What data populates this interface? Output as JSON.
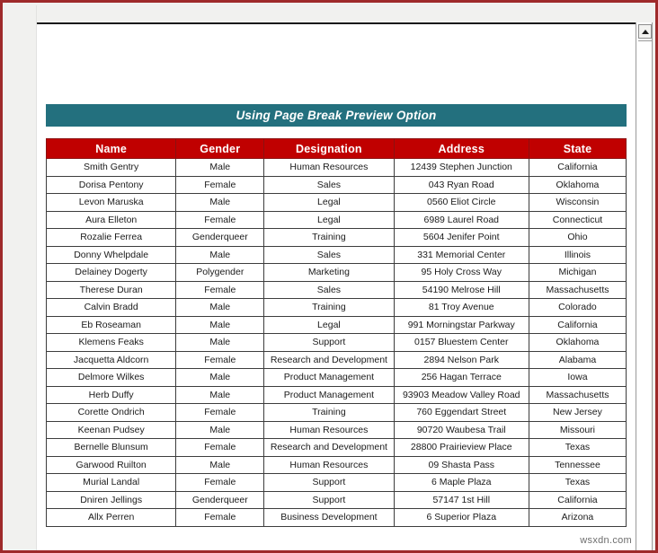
{
  "window": {
    "frame_color": "#9e2a2a",
    "gutter_color": "#f1f1ef"
  },
  "scrollbar": {
    "up_arrow_icon": "triangle-up-icon"
  },
  "banner": {
    "title": "Using Page Break Preview Option",
    "background_color": "#23707e",
    "text_color": "#ffffff"
  },
  "table": {
    "header_background": "#c00000",
    "header_text_color": "#ffffff",
    "columns": [
      "Name",
      "Gender",
      "Designation",
      "Address",
      "State"
    ],
    "rows": [
      [
        "Smith Gentry",
        "Male",
        "Human Resources",
        "12439 Stephen Junction",
        "California"
      ],
      [
        "Dorisa Pentony",
        "Female",
        "Sales",
        "043 Ryan Road",
        "Oklahoma"
      ],
      [
        "Levon Maruska",
        "Male",
        "Legal",
        "0560 Eliot Circle",
        "Wisconsin"
      ],
      [
        "Aura Elleton",
        "Female",
        "Legal",
        "6989 Laurel Road",
        "Connecticut"
      ],
      [
        "Rozalie Ferrea",
        "Genderqueer",
        "Training",
        "5604 Jenifer Point",
        "Ohio"
      ],
      [
        "Donny Whelpdale",
        "Male",
        "Sales",
        "331 Memorial Center",
        "Illinois"
      ],
      [
        "Delainey Dogerty",
        "Polygender",
        "Marketing",
        "95 Holy Cross Way",
        "Michigan"
      ],
      [
        "Therese Duran",
        "Female",
        "Sales",
        "54190 Melrose Hill",
        "Massachusetts"
      ],
      [
        "Calvin Bradd",
        "Male",
        "Training",
        "81 Troy Avenue",
        "Colorado"
      ],
      [
        "Eb Roseaman",
        "Male",
        "Legal",
        "991 Morningstar Parkway",
        "California"
      ],
      [
        "Klemens Feaks",
        "Male",
        "Support",
        "0157 Bluestem Center",
        "Oklahoma"
      ],
      [
        "Jacquetta Aldcorn",
        "Female",
        "Research and Development",
        "2894 Nelson Park",
        "Alabama"
      ],
      [
        "Delmore Wilkes",
        "Male",
        "Product Management",
        "256 Hagan Terrace",
        "Iowa"
      ],
      [
        "Herb Duffy",
        "Male",
        "Product Management",
        "93903 Meadow Valley Road",
        "Massachusetts"
      ],
      [
        "Corette Ondrich",
        "Female",
        "Training",
        "760 Eggendart Street",
        "New Jersey"
      ],
      [
        "Keenan Pudsey",
        "Male",
        "Human Resources",
        "90720 Waubesa Trail",
        "Missouri"
      ],
      [
        "Bernelle Blunsum",
        "Female",
        "Research and Development",
        "28800 Prairieview Place",
        "Texas"
      ],
      [
        "Garwood Ruilton",
        "Male",
        "Human Resources",
        "09 Shasta Pass",
        "Tennessee"
      ],
      [
        "Murial Landal",
        "Female",
        "Support",
        "6 Maple Plaza",
        "Texas"
      ],
      [
        "Dniren Jellings",
        "Genderqueer",
        "Support",
        "57147 1st Hill",
        "California"
      ],
      [
        "Allx Perren",
        "Female",
        "Business Development",
        "6 Superior Plaza",
        "Arizona"
      ]
    ]
  },
  "watermark": {
    "text": "wsxdn.com"
  }
}
